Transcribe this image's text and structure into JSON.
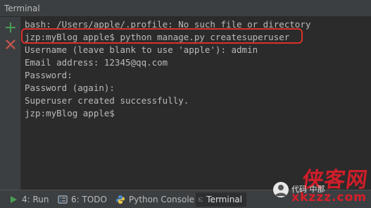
{
  "window": {
    "title": "Terminal"
  },
  "sidebar": {
    "add_icon": "plus-icon",
    "close_icon": "close-icon",
    "add_color": "#499c54",
    "close_color": "#c75450"
  },
  "terminal": {
    "lines": [
      "bash: /Users/apple/.profile: No such file or directory",
      "jzp:myBlog apple$ python manage.py createsuperuser",
      "Username (leave blank to use 'apple'): admin",
      "Email address: 12345@qq.com",
      "Password:",
      "Password (again):",
      "Superuser created successfully.",
      "jzp:myBlog apple$ "
    ],
    "highlight_color": "#d9312b"
  },
  "toolbar": {
    "tabs": [
      {
        "label": "4: Run",
        "icon": "run-icon"
      },
      {
        "label": "6: TODO",
        "icon": "todo-icon"
      },
      {
        "label": "Python Console",
        "icon": "python-icon"
      },
      {
        "label": "Terminal",
        "icon": "terminal-icon",
        "active": true
      }
    ]
  },
  "watermark": {
    "brush_text": "侠客网",
    "caption": "代码 中那",
    "url": "xkzzz.com"
  }
}
